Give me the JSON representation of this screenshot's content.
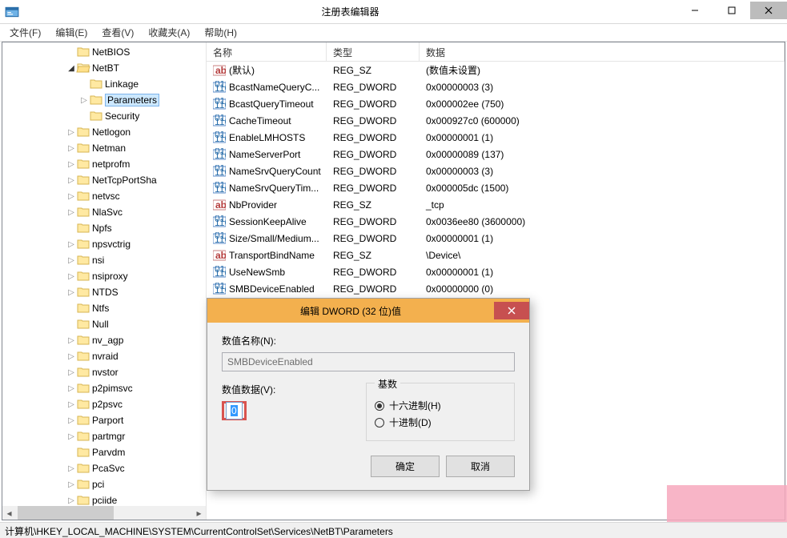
{
  "window": {
    "title": "注册表编辑器",
    "min": "—",
    "max": "□",
    "close": "✕"
  },
  "menu": {
    "file": "文件(F)",
    "edit": "编辑(E)",
    "view": "查看(V)",
    "favorites": "收藏夹(A)",
    "help": "帮助(H)"
  },
  "tree": {
    "items": [
      {
        "indent": 5,
        "exp": "",
        "label": "NetBIOS"
      },
      {
        "indent": 5,
        "exp": "◢",
        "label": "NetBT",
        "open": true
      },
      {
        "indent": 6,
        "exp": "",
        "label": "Linkage"
      },
      {
        "indent": 6,
        "exp": "▷",
        "label": "Parameters",
        "selected": true
      },
      {
        "indent": 6,
        "exp": "",
        "label": "Security"
      },
      {
        "indent": 5,
        "exp": "▷",
        "label": "Netlogon"
      },
      {
        "indent": 5,
        "exp": "▷",
        "label": "Netman"
      },
      {
        "indent": 5,
        "exp": "▷",
        "label": "netprofm"
      },
      {
        "indent": 5,
        "exp": "▷",
        "label": "NetTcpPortSha"
      },
      {
        "indent": 5,
        "exp": "▷",
        "label": "netvsc"
      },
      {
        "indent": 5,
        "exp": "▷",
        "label": "NlaSvc"
      },
      {
        "indent": 5,
        "exp": "",
        "label": "Npfs"
      },
      {
        "indent": 5,
        "exp": "▷",
        "label": "npsvctrig"
      },
      {
        "indent": 5,
        "exp": "▷",
        "label": "nsi"
      },
      {
        "indent": 5,
        "exp": "▷",
        "label": "nsiproxy"
      },
      {
        "indent": 5,
        "exp": "▷",
        "label": "NTDS"
      },
      {
        "indent": 5,
        "exp": "",
        "label": "Ntfs"
      },
      {
        "indent": 5,
        "exp": "",
        "label": "Null"
      },
      {
        "indent": 5,
        "exp": "▷",
        "label": "nv_agp"
      },
      {
        "indent": 5,
        "exp": "▷",
        "label": "nvraid"
      },
      {
        "indent": 5,
        "exp": "▷",
        "label": "nvstor"
      },
      {
        "indent": 5,
        "exp": "▷",
        "label": "p2pimsvc"
      },
      {
        "indent": 5,
        "exp": "▷",
        "label": "p2psvc"
      },
      {
        "indent": 5,
        "exp": "▷",
        "label": "Parport"
      },
      {
        "indent": 5,
        "exp": "▷",
        "label": "partmgr"
      },
      {
        "indent": 5,
        "exp": "",
        "label": "Parvdm"
      },
      {
        "indent": 5,
        "exp": "▷",
        "label": "PcaSvc"
      },
      {
        "indent": 5,
        "exp": "▷",
        "label": "pci"
      },
      {
        "indent": 5,
        "exp": "▷",
        "label": "pciide"
      }
    ]
  },
  "columns": {
    "name": "名称",
    "type": "类型",
    "data": "数据"
  },
  "rows": [
    {
      "icon": "sz",
      "name": "(默认)",
      "type": "REG_SZ",
      "data": "(数值未设置)"
    },
    {
      "icon": "bin",
      "name": "BcastNameQueryC...",
      "type": "REG_DWORD",
      "data": "0x00000003 (3)"
    },
    {
      "icon": "bin",
      "name": "BcastQueryTimeout",
      "type": "REG_DWORD",
      "data": "0x000002ee (750)"
    },
    {
      "icon": "bin",
      "name": "CacheTimeout",
      "type": "REG_DWORD",
      "data": "0x000927c0 (600000)"
    },
    {
      "icon": "bin",
      "name": "EnableLMHOSTS",
      "type": "REG_DWORD",
      "data": "0x00000001 (1)"
    },
    {
      "icon": "bin",
      "name": "NameServerPort",
      "type": "REG_DWORD",
      "data": "0x00000089 (137)"
    },
    {
      "icon": "bin",
      "name": "NameSrvQueryCount",
      "type": "REG_DWORD",
      "data": "0x00000003 (3)"
    },
    {
      "icon": "bin",
      "name": "NameSrvQueryTim...",
      "type": "REG_DWORD",
      "data": "0x000005dc (1500)"
    },
    {
      "icon": "sz",
      "name": "NbProvider",
      "type": "REG_SZ",
      "data": "_tcp"
    },
    {
      "icon": "bin",
      "name": "SessionKeepAlive",
      "type": "REG_DWORD",
      "data": "0x0036ee80 (3600000)"
    },
    {
      "icon": "bin",
      "name": "Size/Small/Medium...",
      "type": "REG_DWORD",
      "data": "0x00000001 (1)"
    },
    {
      "icon": "sz",
      "name": "TransportBindName",
      "type": "REG_SZ",
      "data": "\\Device\\"
    },
    {
      "icon": "bin",
      "name": "UseNewSmb",
      "type": "REG_DWORD",
      "data": "0x00000001 (1)"
    },
    {
      "icon": "bin",
      "name": "SMBDeviceEnabled",
      "type": "REG_DWORD",
      "data": "0x00000000 (0)"
    }
  ],
  "dialog": {
    "title": "编辑 DWORD (32 位)值",
    "name_label": "数值名称(N):",
    "name_value": "SMBDeviceEnabled",
    "data_label": "数值数据(V):",
    "data_value": "0",
    "base_label": "基数",
    "hex": "十六进制(H)",
    "dec": "十进制(D)",
    "ok": "确定",
    "cancel": "取消"
  },
  "status": "计算机\\HKEY_LOCAL_MACHINE\\SYSTEM\\CurrentControlSet\\Services\\NetBT\\Parameters"
}
